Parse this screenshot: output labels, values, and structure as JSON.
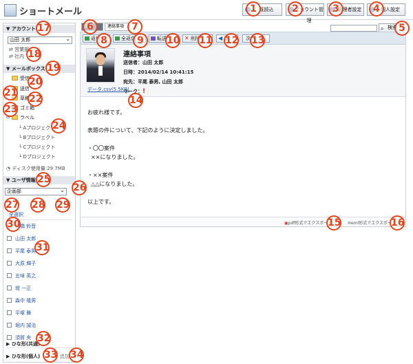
{
  "app": {
    "title": "ショートメール"
  },
  "header_buttons": [
    {
      "label": "既読込"
    },
    {
      "label": "アカウント管理"
    },
    {
      "label": "管理者設定"
    },
    {
      "label": "個人設定"
    }
  ],
  "search": {
    "button": "検索",
    "placeholder": ""
  },
  "sidebar": {
    "account": {
      "title": "アカウント",
      "selected": "山田 太郎",
      "items": [
        "営業部",
        "社内"
      ]
    },
    "mailbox": {
      "title": "メールボックス",
      "folders": [
        "受信",
        "送信",
        "草稿",
        "ゴミ箱",
        "ラベル"
      ],
      "labels": [
        "Aプロジェクト",
        "Bプロジェクト",
        "Cプロジェクト",
        "Dプロジェクト"
      ],
      "disk": "ディスク使用量:29.7MB"
    },
    "user_info": {
      "title": "ユーザ情報",
      "group": "企画部",
      "select_all": "全選択",
      "users": [
        "高橋 鈴音",
        "山田 太郎",
        "平尾 泰男",
        "大原 輝子",
        "五味 英之",
        "堤 一正",
        "森中 隆男",
        "平塚 舞",
        "堀内 誠治",
        "須賀 央"
      ]
    },
    "template_shared": "ひな形(共通)",
    "template_personal": "ひな形(個人)",
    "template_extra": "追加"
  },
  "tabs": [
    "受信",
    "連絡事項"
  ],
  "toolbar": [
    "返信",
    "全返信",
    "転送",
    "削除",
    "前",
    "次へ"
  ],
  "message": {
    "subject": "連絡事項",
    "from_label": "送信者",
    "from": "山田 太郎",
    "date_label": "日時",
    "date": "2014/02/14 10:41:15",
    "to_label": "宛先",
    "to": "平尾 泰男, 山田 太郎",
    "mark_label": "マーク",
    "mark": "!",
    "attachment": "データ.csv(5.5KB)",
    "body": "お疲れ様です。\n\n表題の件について、下記のように決定しました。\n\n・〇〇案件\n  ××になりました。\n\n・××案件\n  △△になりました。\n\n以上です。",
    "export_pdf": "pdf形式でエクスポート",
    "export_eml": "eml形式でエクスポート"
  },
  "callouts": [
    "1",
    "2",
    "3",
    "4",
    "5",
    "6",
    "7",
    "8",
    "9",
    "10",
    "11",
    "12",
    "13",
    "14",
    "15",
    "16",
    "17",
    "18",
    "19",
    "20",
    "21",
    "22",
    "23",
    "24",
    "25",
    "26",
    "27",
    "28",
    "29",
    "30",
    "31",
    "32",
    "33",
    "34"
  ],
  "colors": {
    "callout": "#e0451f",
    "header_bg": "#e3e7ec",
    "link": "#2a58a8"
  }
}
